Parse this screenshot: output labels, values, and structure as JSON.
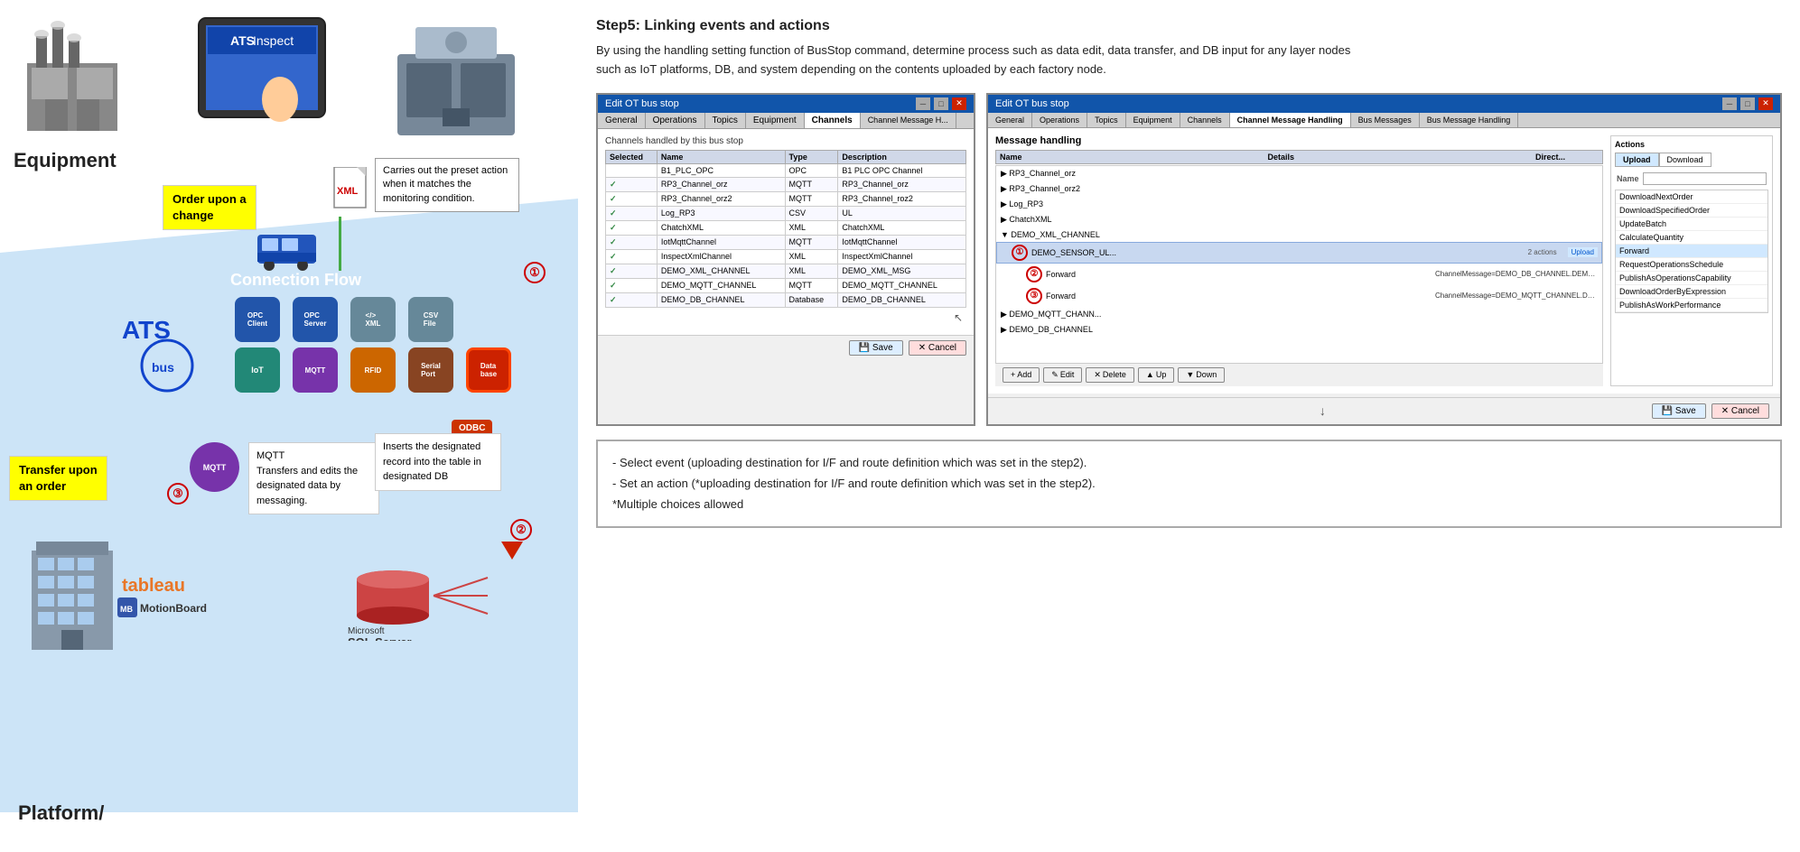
{
  "left": {
    "equipment_label": "Equipment",
    "platform_label": "Platform/",
    "order_change_balloon": "Order upon a\nchange",
    "transfer_order_balloon": "Transfer upon\nan order",
    "carries_out_bubble": "Carries out the preset action when it matches the monitoring condition.",
    "circle1": "①",
    "circle2": "②",
    "circle3": "③",
    "mqtt_text": "MQTT\nTransfers and edits the designated data by messaging.",
    "db_insert_text": "Inserts the designated record into the table in designated DB",
    "xml_label": "XML",
    "connection_flow_label": "Connection\nFlow",
    "icons": [
      {
        "label": "OPC\nClient",
        "type": "blue"
      },
      {
        "label": "OPC\nServer",
        "type": "blue"
      },
      {
        "label": "XML\nFile",
        "type": "gray"
      },
      {
        "label": "CSV\nFile",
        "type": "gray"
      },
      {
        "label": "",
        "type": "empty"
      },
      {
        "label": "IoT",
        "type": "teal"
      },
      {
        "label": "MQTT",
        "type": "purple"
      },
      {
        "label": "RFID",
        "type": "orange"
      },
      {
        "label": "Serial\nPort",
        "type": "brown"
      },
      {
        "label": "Database",
        "type": "red"
      }
    ]
  },
  "right": {
    "step_title": "Step5: Linking events and actions",
    "step_desc": "By using the handling setting function of BusStop command, determine process such as data edit, data transfer, and DB input for any layer nodes such as IoT platforms, DB, and system depending on the contents uploaded by each factory node.",
    "window_left": {
      "title": "Edit OT bus stop",
      "tabs": [
        "General",
        "Operations",
        "Topics",
        "Equipment",
        "Channels",
        "Channel Message H..."
      ],
      "active_tab": "Channels",
      "channels_label": "Channels handled by this bus stop",
      "columns": [
        "Selected",
        "Name",
        "Type",
        "Description"
      ],
      "rows": [
        {
          "selected": "",
          "name": "B1_PLC_OPC",
          "type": "OPC",
          "desc": "B1 PLC OPC Channel"
        },
        {
          "selected": "✓",
          "name": "RP3_Channel_orz",
          "type": "MQTT",
          "desc": "RP3_Channel_orz"
        },
        {
          "selected": "✓",
          "name": "RP3_Channel_orz2",
          "type": "MQTT",
          "desc": "RP3_Channel_roz2"
        },
        {
          "selected": "✓",
          "name": "Log_RP3",
          "type": "CSV",
          "desc": "UL"
        },
        {
          "selected": "✓",
          "name": "ChatchXML",
          "type": "XML",
          "desc": "ChatchXML"
        },
        {
          "selected": "✓",
          "name": "IotMqttChannel",
          "type": "MQTT",
          "desc": "IotMqttChannel"
        },
        {
          "selected": "✓",
          "name": "InspectXmlChannel",
          "type": "XML",
          "desc": "InspectXmlChannel"
        },
        {
          "selected": "✓",
          "name": "DEMO_XML_CHANNEL",
          "type": "XML",
          "desc": "DEMO_XML_MSG"
        },
        {
          "selected": "✓",
          "name": "DEMO_MQTT_CHANNEL",
          "type": "MQTT",
          "desc": "DEMO_MQTT_CHANNEL"
        },
        {
          "selected": "✓",
          "name": "DEMO_DB_CHANNEL",
          "type": "Database",
          "desc": "DEMO_DB_CHANNEL"
        }
      ],
      "save_label": "Save",
      "cancel_label": "Cancel"
    },
    "window_right": {
      "title": "Edit OT bus stop",
      "tabs": [
        "General",
        "Operations",
        "Topics",
        "Equipment",
        "Channels",
        "Channel Message Handling",
        "Bus Messages",
        "Bus Message Handling"
      ],
      "active_tab": "Channel Message Handling",
      "message_handling_label": "Message handling",
      "tree_columns": [
        "Name",
        "Details",
        "Direct..."
      ],
      "tree_items": [
        {
          "label": "RP3_Channel_orz",
          "level": 0,
          "expanded": true
        },
        {
          "label": "RP3_Channel_orz2",
          "level": 0
        },
        {
          "label": "Log_RP3",
          "level": 0
        },
        {
          "label": "ChatchXML",
          "level": 0
        },
        {
          "label": "DEMO_XML_CHANNEL",
          "level": 0
        },
        {
          "label": "DEMO_SENSOR_UL...",
          "level": 1,
          "circle": "①",
          "actions_count": "2 actions",
          "direction": "Upload"
        },
        {
          "label": "Forward",
          "level": 2,
          "circle": "②",
          "detail": "ChannelMessage=DEMO_DB_CHANNEL.DEMO_SENSOR_DL..Co..."
        },
        {
          "label": "Forward",
          "level": 2,
          "circle": "③",
          "detail": "ChannelMessage=DEMO_MQTT_CHANNEL.DEMO_SENSOR_DL..."
        },
        {
          "label": "DEMO_MQTT_CHANN...",
          "level": 0
        },
        {
          "label": "DEMO_DB_CHANNEL",
          "level": 0
        }
      ],
      "footer_btns": [
        "Add",
        "Edit",
        "Delete",
        "Up",
        "Down"
      ],
      "actions_label": "Actions",
      "action_tabs": [
        "Upload",
        "Download"
      ],
      "active_action_tab": "Upload",
      "action_items": [
        "Name",
        "DownloadNextOrder",
        "DownloadSpecifiedOrder",
        "UpdateBatch",
        "CalculateQuantity",
        "Forward",
        "RequestOperationsSchedule",
        "PublishAsOperationsCapability",
        "DownloadOrderByExpression",
        "PublishAsWorkPerformance"
      ],
      "selected_action": "Forward",
      "save_label": "Save",
      "cancel_label": "Cancel"
    },
    "notes": [
      "- Select event (uploading destination for I/F and route definition which was set in the step2).",
      "- Set an action (*uploading destination for I/F and route definition which was set in the step2).",
      "*Multiple choices allowed"
    ]
  }
}
